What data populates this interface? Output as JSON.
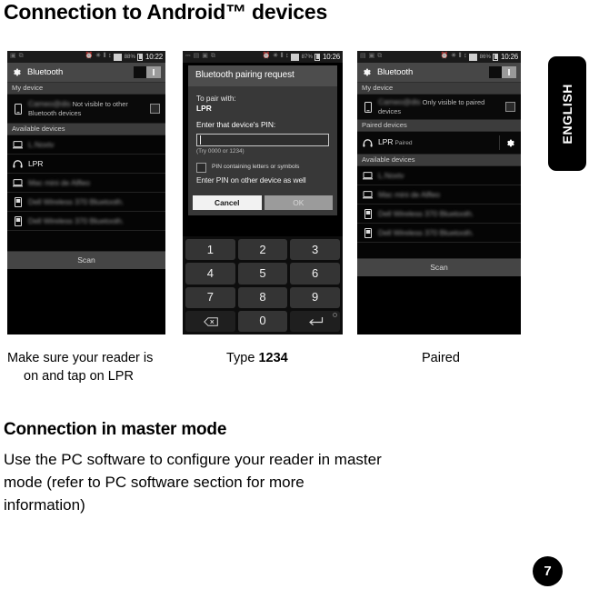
{
  "page": {
    "title": "Connection to Android™ devices",
    "section_heading": "Connection in master mode",
    "body_line1": "Use the PC software to configure your reader in master",
    "body_line2": "mode (refer to PC software section for more",
    "body_line3": "information)",
    "language_tab": "ENGLISH",
    "page_number": "7"
  },
  "captions": {
    "step1_line1": "Make sure your reader is",
    "step1_line2": "on and tap on LPR",
    "step2_prefix": "Type ",
    "step2_pin": "1234",
    "step3": "Paired"
  },
  "phone1": {
    "statusbar": {
      "battery_pct": "88%",
      "time": "10:22"
    },
    "actionbar": {
      "title": "Bluetooth",
      "toggle_state": "on"
    },
    "section_my_device": "My device",
    "my_device": {
      "name": "Cameo@dis",
      "subtitle": "Not visible to other Bluetooth devices",
      "checkbox": "unchecked"
    },
    "section_available": "Available devices",
    "devices": [
      {
        "name": "L.Noxtv",
        "icon": "laptop-icon",
        "redacted": true
      },
      {
        "name": "LPR",
        "icon": "headset-icon",
        "redacted": false
      },
      {
        "name": "Mac mini de Alfleo",
        "icon": "laptop-icon",
        "redacted": true
      },
      {
        "name": "Dell Wireless 370 Bluetooth.",
        "icon": "phone-icon",
        "redacted": true
      },
      {
        "name": "Dell Wireless 370 Bluetooth.",
        "icon": "phone-icon",
        "redacted": true
      }
    ],
    "scan_button": "Scan"
  },
  "phone2": {
    "statusbar": {
      "battery_pct": "87%",
      "time": "10:26"
    },
    "dialog": {
      "title": "Bluetooth pairing request",
      "pair_with_label": "To pair with:",
      "pair_with_value": "LPR",
      "pin_label": "Enter that device's PIN:",
      "pin_value": "",
      "pin_hint": "(Try 0000 or 1234)",
      "checkbox_label": "PIN containing letters or symbols",
      "checkbox_state": "unchecked",
      "note": "Enter PIN on other device as well",
      "cancel_button": "Cancel",
      "ok_button": "OK"
    },
    "keypad": [
      "1",
      "2",
      "3",
      "4",
      "5",
      "6",
      "7",
      "8",
      "9",
      "backspace-key",
      "0",
      "enter-key"
    ]
  },
  "phone3": {
    "statusbar": {
      "battery_pct": "86%",
      "time": "10:26"
    },
    "actionbar": {
      "title": "Bluetooth",
      "toggle_state": "on"
    },
    "section_my_device": "My device",
    "my_device": {
      "name": "Cameo@dis",
      "subtitle": "Only visible to paired devices",
      "checkbox": "unchecked"
    },
    "section_paired": "Paired devices",
    "paired_device": {
      "name": "LPR",
      "status": "Paired",
      "icon": "headset-icon"
    },
    "section_available": "Available devices",
    "devices": [
      {
        "name": "L.Noxtv",
        "icon": "laptop-icon",
        "redacted": true
      },
      {
        "name": "Mac mini de Alfleo",
        "icon": "laptop-icon",
        "redacted": true
      },
      {
        "name": "Dell Wireless 370 Bluetooth.",
        "icon": "phone-icon",
        "redacted": true
      },
      {
        "name": "Dell Wireless 370 Bluetooth.",
        "icon": "phone-icon",
        "redacted": true
      }
    ],
    "scan_button": "Scan"
  },
  "colors": {
    "page_bg": "#ffffff",
    "text": "#000000",
    "phone_bg": "#050505",
    "actionbar": "#474747",
    "section_strip": "#3c3c3c",
    "dialog_bg": "#383838",
    "dialog_title_bg": "#4d4d4d"
  }
}
